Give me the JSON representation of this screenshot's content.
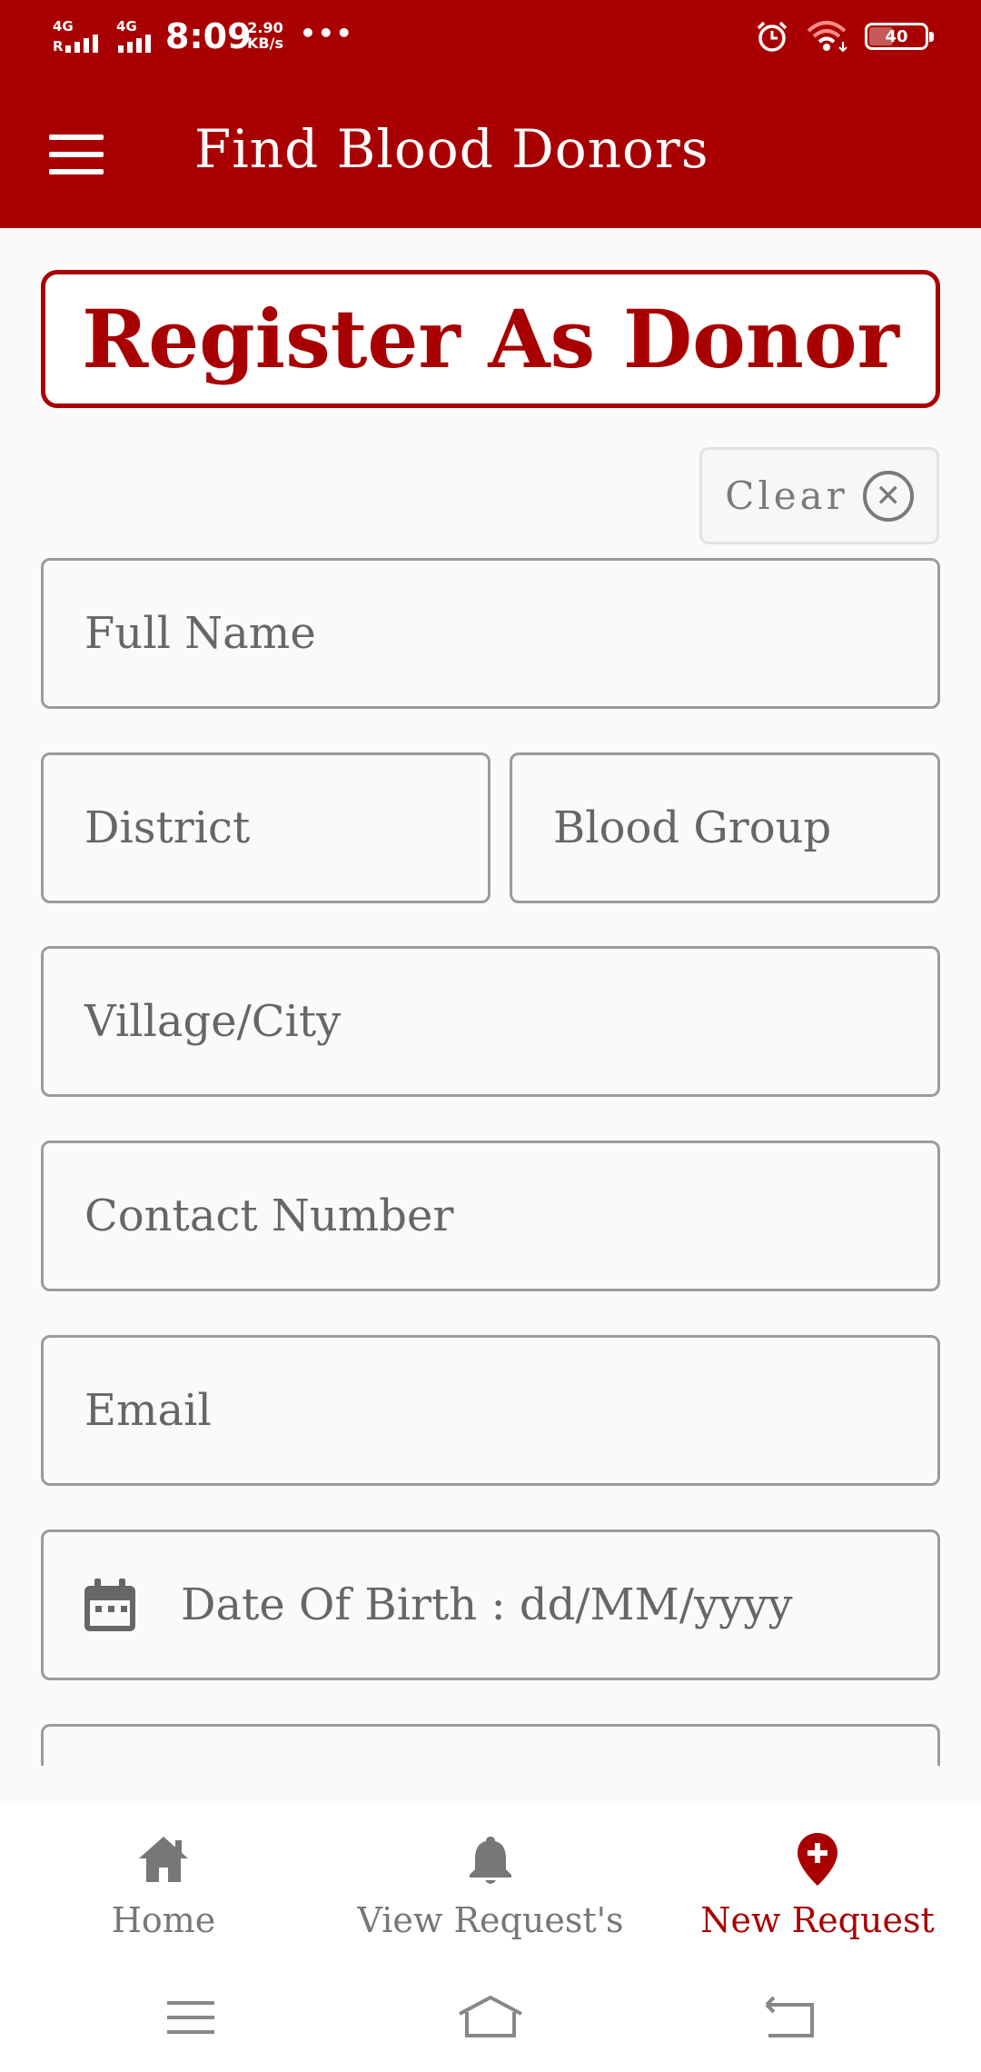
{
  "status_bar": {
    "network_1": "4G",
    "network_1_sub": "R",
    "network_2": "4G",
    "time": "8:09",
    "speed_value": "2.90",
    "speed_unit": "KB/s",
    "more": "•••",
    "battery": "40",
    "icons": [
      "alarm-icon",
      "wifi-icon",
      "battery-icon"
    ]
  },
  "app_bar": {
    "menu_icon": "hamburger-menu-icon",
    "title": "Find Blood Donors",
    "background": "#a80000"
  },
  "header": {
    "title": "Register As Donor"
  },
  "clear_button": {
    "label": "Clear",
    "icon": "close-circle-icon"
  },
  "form": {
    "full_name": {
      "placeholder": "Full Name",
      "value": ""
    },
    "district": {
      "placeholder": "District",
      "value": ""
    },
    "blood_group": {
      "placeholder": "Blood Group",
      "value": ""
    },
    "village_city": {
      "placeholder": "Village/City",
      "value": ""
    },
    "contact_number": {
      "placeholder": "Contact Number",
      "value": ""
    },
    "email": {
      "placeholder": "Email",
      "value": ""
    },
    "date_of_birth": {
      "placeholder": "Date Of Birth : dd/MM/yyyy",
      "value": "",
      "icon": "calendar-icon"
    }
  },
  "bottom_nav": {
    "items": [
      {
        "label": "Home",
        "icon": "home-icon",
        "active": false
      },
      {
        "label": "View Request's",
        "icon": "bell-icon",
        "active": false
      },
      {
        "label": "New Request",
        "icon": "location-plus-icon",
        "active": true
      }
    ],
    "active_color": "#a80000",
    "inactive_color": "#777777"
  },
  "system_nav": [
    "recents-icon",
    "home-outline-icon",
    "back-icon"
  ]
}
